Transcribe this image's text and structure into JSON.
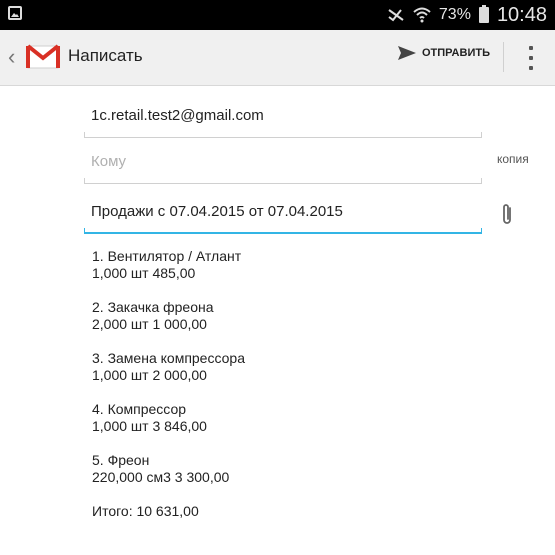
{
  "status_bar": {
    "battery_percent": "73%",
    "time": "10:48",
    "icons": [
      "gallery-icon",
      "mute-icon",
      "wifi-icon",
      "battery-icon"
    ]
  },
  "action_bar": {
    "title": "Написать",
    "send_label": "ОТПРАВИТЬ",
    "icons": [
      "back-icon",
      "gmail-logo-icon",
      "send-icon",
      "overflow-menu-icon"
    ]
  },
  "compose": {
    "from": "1c.retail.test2@gmail.com",
    "to_placeholder": "Кому",
    "cc_label": "копия",
    "subject": "Продажи с 07.04.2015 от 07.04.2015",
    "items": [
      {
        "line1": "1. Вентилятор / Атлант",
        "line2": "1,000 шт 485,00"
      },
      {
        "line1": "2. Закачка фреона",
        "line2": "2,000 шт 1 000,00"
      },
      {
        "line1": "3. Замена компрессора",
        "line2": "1,000 шт 2 000,00"
      },
      {
        "line1": "4. Компрессор",
        "line2": "1,000 шт 3 846,00"
      },
      {
        "line1": "5. Фреон",
        "line2": "220,000 см3 3 300,00"
      }
    ],
    "total": "Итого: 10 631,00"
  },
  "colors": {
    "accent": "#33b5e5",
    "gmail_red": "#d93025"
  }
}
